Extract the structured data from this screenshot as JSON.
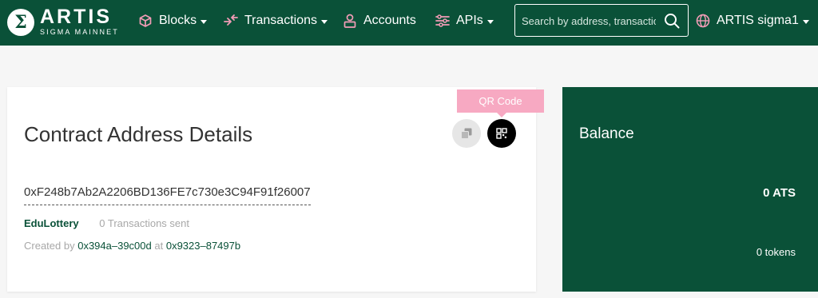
{
  "header": {
    "logo_mark": "Σ",
    "logo_name": "ARTIS",
    "logo_sub": "SIGMA MAINNET",
    "nav": {
      "blocks": "Blocks",
      "transactions": "Transactions",
      "accounts": "Accounts",
      "apis": "APIs"
    },
    "search_placeholder": "Search by address, transaction hash, block number",
    "network": "ARTIS sigma1"
  },
  "address_card": {
    "title": "Contract Address Details",
    "tooltip": "QR Code",
    "address": "0xF248b7Ab2A2206BD136FE7c730e3C94F91f26007",
    "contract_name": "EduLottery",
    "transactions_sent": "0 Transactions sent",
    "created_by_label": "Created by",
    "creator": "0x394a–39c00d",
    "at_label": "at",
    "creation_tx": "0x9323–87497b"
  },
  "balance": {
    "title": "Balance",
    "value": "0 ATS",
    "tokens": "0 tokens"
  },
  "colors": {
    "brand": "#0a5138",
    "tooltip": "#f7a9c2"
  }
}
